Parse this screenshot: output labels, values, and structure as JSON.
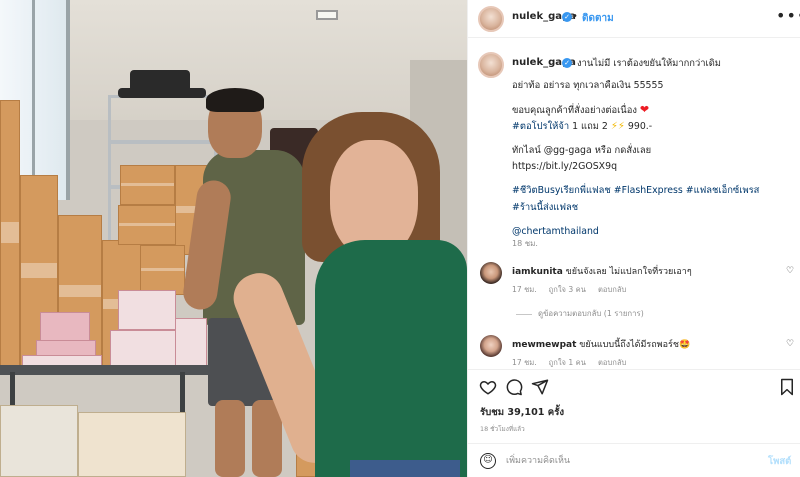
{
  "post": {
    "username": "nulek_gaga",
    "verified_mark": "✓",
    "separator": "•",
    "follow_label": "ติดตาม",
    "more_icon": "•••"
  },
  "caption": {
    "username": "nulek_gaga",
    "first_line": "งานไม่มี เราต้องขยันให้มากกว่าเดิม",
    "line2": "อย่าท้อ อย่ารอ ทุกเวลาคือเงิน 55555",
    "line3": "ขอบคุณลูกค้าที่สั่งอย่างต่อเนื่อง",
    "heart_emoji": "❤",
    "promo_tag": "#ตอโปรให้จ้า",
    "promo_text": " 1 แถม 2 ",
    "bolt_emoji": "⚡⚡",
    "promo_price": " 990.-",
    "line_contact": "ทักไลน์ @gg-gaga หรือ กดสั่งเลย",
    "link": "https://bit.ly/2GOSX9q",
    "hashtags_line1": "#ชีวิตBusyเรียกพี่แฟลช #FlashExpress #แฟลชเอ็กซ์เพรส",
    "hashtags_line2": "#ร้านนี้ส่งแฟลช",
    "mention": "@chertamthailand",
    "time": "18 ชม."
  },
  "comments": [
    {
      "username": "iamkunita",
      "text": " ขยันจังเลย ไม่แปลกใจที่รวยเอาๆ",
      "time": "17 ชม.",
      "likes": "ถูกใจ 3 คน",
      "reply": "ตอบกลับ",
      "avatar_color": "#3b2a24"
    },
    {
      "username": "mewmewpat",
      "text": " ขยันแบบนี้ถึงได้มีรถพอร์ช🤩",
      "time": "17 ชม.",
      "likes": "ถูกใจ 1 คน",
      "reply": "ตอบกลับ",
      "avatar_color": "#5a3b33"
    }
  ],
  "view_replies": "ดูข้อความตอบกลับ (1 รายการ)",
  "actions": {
    "like_icon": "♡",
    "comment_icon": "◯",
    "share_icon": "➤",
    "save_icon": "▯"
  },
  "likes_text": "รับชม 39,101 ครั้ง",
  "posted_ago": "18 ชั่วโมงที่แล้ว",
  "add_comment": {
    "placeholder": "เพิ่มความคิดเห็น",
    "post_label": "โพสต์",
    "emoji_icon": "☺"
  },
  "colors": {
    "link": "#00376b",
    "follow": "#3897f0",
    "post_disabled": "#b2dffc",
    "muted": "#8e8e8e"
  }
}
